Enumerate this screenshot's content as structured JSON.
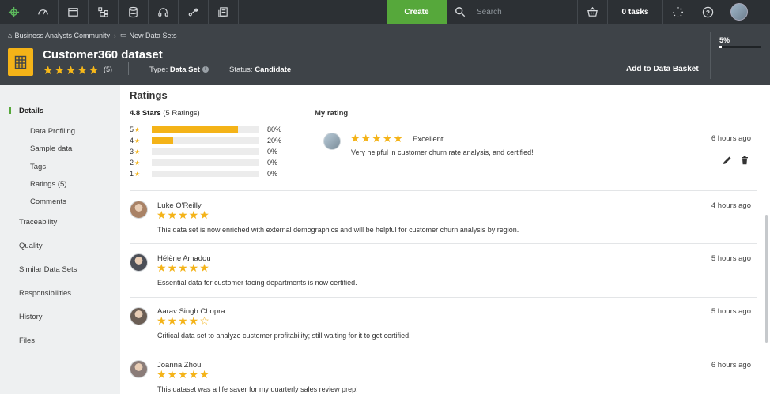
{
  "topbar": {
    "create_label": "Create",
    "search_placeholder": "Search",
    "tasks_label": "0 tasks",
    "icons": [
      "logo-icon",
      "dashboard-icon",
      "window-icon",
      "hierarchy-icon",
      "database-icon",
      "headset-icon",
      "share-icon",
      "report-icon",
      "basket-icon",
      "loading-icon",
      "help-icon"
    ]
  },
  "breadcrumb": {
    "items": [
      "Business Analysts Community",
      "New Data Sets"
    ]
  },
  "dataset": {
    "title": "Customer360 dataset",
    "rating_stars": "★★★★★",
    "rating_count": "(5)",
    "type_label": "Type:",
    "type_value": "Data Set",
    "status_label": "Status:",
    "status_value": "Candidate",
    "basket_action": "Add to Data Basket",
    "progress_label": "5%",
    "progress_value": 0.05
  },
  "sidebar": {
    "items": [
      {
        "label": "Details"
      },
      {
        "label": "Data Profiling"
      },
      {
        "label": "Sample data"
      },
      {
        "label": "Tags"
      },
      {
        "label": "Ratings (5)"
      },
      {
        "label": "Comments"
      },
      {
        "label": "Traceability"
      },
      {
        "label": "Quality"
      },
      {
        "label": "Similar Data Sets"
      },
      {
        "label": "Responsibilities"
      },
      {
        "label": "History"
      },
      {
        "label": "Files"
      }
    ]
  },
  "ratings": {
    "section_title": "Ratings",
    "summary_bold": "4.8 Stars",
    "summary_rest": " (5 Ratings)",
    "distribution": [
      {
        "stars": "5",
        "star_glyph": "★",
        "percent_label": "80%",
        "fraction": 0.8
      },
      {
        "stars": "4",
        "star_glyph": "★",
        "percent_label": "20%",
        "fraction": 0.2
      },
      {
        "stars": "3",
        "star_glyph": "★",
        "percent_label": "0%",
        "fraction": 0.0
      },
      {
        "stars": "2",
        "star_glyph": "★",
        "percent_label": "0%",
        "fraction": 0.0
      },
      {
        "stars": "1",
        "star_glyph": "★",
        "percent_label": "0%",
        "fraction": 0.0
      }
    ],
    "my_rating": {
      "title": "My rating",
      "stars": "★★★★★",
      "label": "Excellent",
      "text": "Very helpful in customer churn rate analysis, and certified!",
      "time": "6 hours ago"
    },
    "reviews": [
      {
        "name": "Luke O'Reilly",
        "stars": "★★★★★",
        "text": "This data set is now enriched with external demographics and will be helpful for customer churn analysis by region.",
        "time": "4 hours ago",
        "avatar_color": "#a98266"
      },
      {
        "name": "Hélène Amadou",
        "stars": "★★★★★",
        "text": "Essential data for customer facing departments is now certified.",
        "time": "5 hours ago",
        "avatar_color": "#4c4f57"
      },
      {
        "name": "Aarav Singh Chopra",
        "stars": "★★★★☆",
        "text": "Critical data set to analyze customer profitability; still waiting for it to get certified.",
        "time": "5 hours ago",
        "avatar_color": "#6b5e55"
      },
      {
        "name": "Joanna Zhou",
        "stars": "★★★★★",
        "text": "This dataset was a life saver for my quarterly sales review prep!",
        "time": "6 hours ago",
        "avatar_color": "#8a7c78"
      }
    ]
  }
}
